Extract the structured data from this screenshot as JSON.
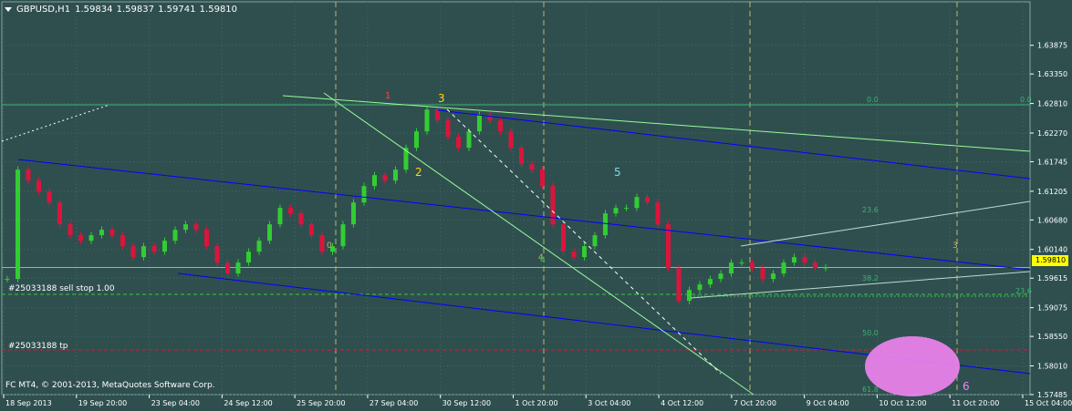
{
  "header": {
    "symbol": "GBPUSD,H1",
    "ohlc": "1.59834 1.59837 1.59741 1.59810"
  },
  "footer": {
    "copyright": "FC MT4, © 2001-2013, MetaQuotes Software Corp."
  },
  "orders": {
    "sell_stop_label": "#25033188 sell stop 1.00",
    "tp_label": "#25033188 tp"
  },
  "colors": {
    "background": "#2f4f4f",
    "grid": "#3f6a64",
    "bull_candle": "#32cd32",
    "bear_candle": "#dc143c",
    "channel_line": "#0000ff",
    "trend_line": "#98fb98",
    "fib_text": "#3cb371",
    "vertical_marker": "#bdb76b",
    "price_tag": "#ffff00",
    "tp_line": "#dc143c",
    "target_ellipse": "#ee82ee",
    "wave_label_yellow": "#ffd700",
    "wave_label_red": "#ff4040",
    "wave_label_blue": "#7fd8e8",
    "wave_label_violet": "#ee82ee"
  },
  "chart_data": {
    "type": "candlestick",
    "symbol": "GBPUSD",
    "timeframe": "H1",
    "current_price": "1.59810",
    "ylim": [
      1.57485,
      1.6437
    ],
    "y_ticks": [
      "1.63875",
      "1.63350",
      "1.62810",
      "1.62270",
      "1.61745",
      "1.61205",
      "1.60680",
      "1.60140",
      "1.59615",
      "1.59075",
      "1.58550",
      "1.58010",
      "1.57485"
    ],
    "x_ticks": [
      "18 Sep 2013",
      "19 Sep 20:00",
      "23 Sep 04:00",
      "24 Sep 12:00",
      "25 Sep 20:00",
      "27 Sep 04:00",
      "30 Sep 12:00",
      "1 Oct 20:00",
      "3 Oct 04:00",
      "4 Oct 12:00",
      "7 Oct 20:00",
      "9 Oct 04:00",
      "10 Oct 12:00",
      "11 Oct 20:00",
      "15 Oct 04:00"
    ],
    "series": [
      {
        "name": "",
        "close": [
          1.596,
          1.616,
          1.614,
          1.612,
          1.61,
          1.606,
          1.604,
          1.603,
          1.604,
          1.605,
          1.604,
          1.602,
          1.6,
          1.602,
          1.601,
          1.603,
          1.605,
          1.606,
          1.605,
          1.602,
          1.599,
          1.597,
          1.599,
          1.601,
          1.603,
          1.606,
          1.609,
          1.608,
          1.606,
          1.604,
          1.601,
          1.602,
          1.606,
          1.61,
          1.613,
          1.615,
          1.614,
          1.616,
          1.62,
          1.623,
          1.627,
          1.625,
          1.622,
          1.62,
          1.623,
          1.626,
          1.625,
          1.623,
          1.62,
          1.617,
          1.616,
          1.613,
          1.606,
          1.601,
          1.6,
          1.602,
          1.604,
          1.608,
          1.609,
          1.609,
          1.611,
          1.61,
          1.606,
          1.598,
          1.592,
          1.594,
          1.595,
          1.596,
          1.597,
          1.599,
          1.599,
          1.598,
          1.596,
          1.597,
          1.599,
          1.6,
          1.599,
          1.598,
          1.5981
        ]
      }
    ],
    "annotations": {
      "vertical_markers": [
        "0",
        "4",
        "3"
      ],
      "waves": [
        "1",
        "2",
        "3",
        "4",
        "5",
        "6"
      ],
      "fib_levels": [
        "0.0",
        "23.6",
        "38.2",
        "23.6",
        "50.0",
        "61.8"
      ]
    }
  }
}
